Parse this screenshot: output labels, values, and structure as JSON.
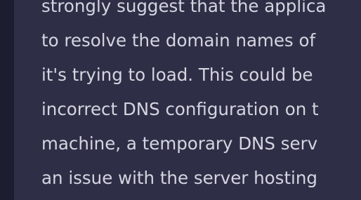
{
  "message": {
    "lines": [
      "strongly suggest that the applica",
      "to resolve the domain names of",
      "it's trying to load. This could be",
      "incorrect DNS configuration on t",
      "machine, a temporary DNS serv",
      "an issue with the server hosting"
    ]
  },
  "colors": {
    "background": "#2e2f46",
    "left_rail": "#1d1d30",
    "text": "#d4d5e0"
  }
}
